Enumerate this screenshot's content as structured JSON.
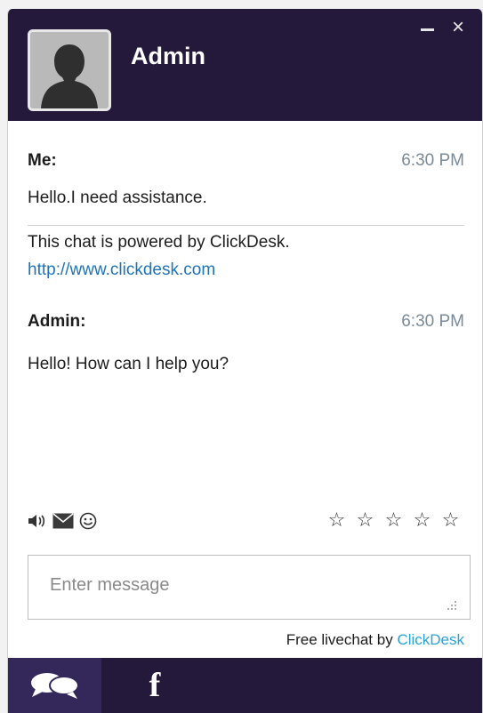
{
  "header": {
    "agent_name": "Admin",
    "minimize_icon": "minimize-icon",
    "close_icon": "close-icon",
    "close_glyph": "×"
  },
  "messages": [
    {
      "sender": "Me:",
      "time": "6:30 PM",
      "text": "Hello.I need assistance."
    },
    {
      "sender": "Admin:",
      "time": "6:30 PM",
      "text": "Hello! How can I help you?"
    }
  ],
  "system_notice": {
    "text": "This chat is powered by ClickDesk.",
    "link": "http://www.clickdesk.com"
  },
  "toolbar": {
    "icons": [
      "sound-icon",
      "email-icon",
      "emoji-icon"
    ],
    "rating_stars": [
      "☆",
      "☆",
      "☆",
      "☆",
      "☆"
    ]
  },
  "input": {
    "placeholder": "Enter message",
    "value": ""
  },
  "footer": {
    "powered_prefix": "Free livechat by",
    "powered_brand": "ClickDesk",
    "facebook_glyph": "f"
  },
  "colors": {
    "header_bg": "#24193b",
    "footer_active_tab": "#34285a",
    "link": "#1f73b7",
    "brand": "#29a3d6",
    "timestamp": "#7a8a9a"
  }
}
